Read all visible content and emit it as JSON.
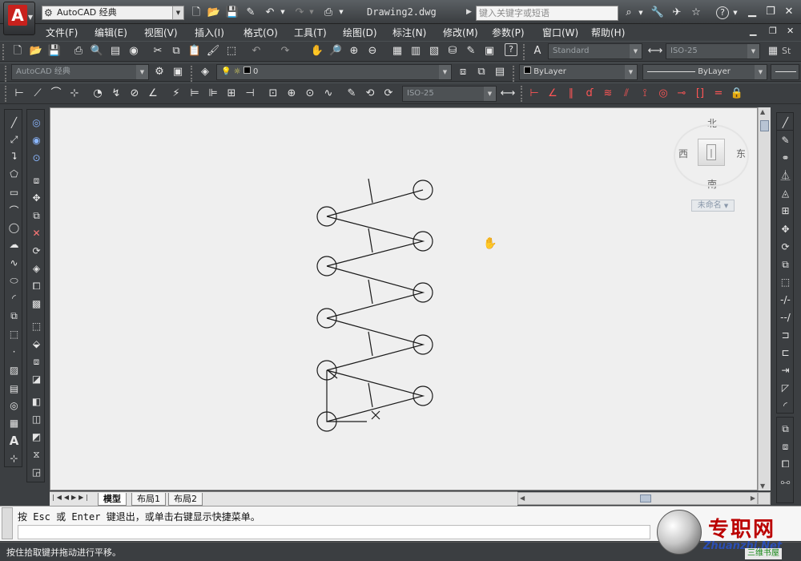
{
  "app": {
    "workspace": "AutoCAD 经典",
    "document_title": "Drawing2.dwg",
    "search_placeholder": "键入关键字或短语"
  },
  "menu": [
    "文件(F)",
    "编辑(E)",
    "视图(V)",
    "插入(I)",
    "格式(O)",
    "工具(T)",
    "绘图(D)",
    "标注(N)",
    "修改(M)",
    "参数(P)",
    "窗口(W)",
    "帮助(H)"
  ],
  "toolbars": {
    "text_style": "Standard",
    "dim_style": "ISO-25",
    "workspace_combo": "AutoCAD 经典",
    "layer_value": "0",
    "color_value": "ByLayer",
    "linetype_value": "ByLayer",
    "dim_style2": "ISO-25",
    "table_style_label": "St"
  },
  "viewcube": {
    "north": "北",
    "south": "南",
    "east": "东",
    "west": "西",
    "ucs": "未命名"
  },
  "layout_tabs": [
    "模型",
    "布局1",
    "布局2"
  ],
  "command": {
    "prompt": "按 Esc 或 Enter 键退出，或单击右键显示快捷菜单。"
  },
  "status_bar": {
    "message": "按住拾取键并拖动进行平移。"
  },
  "watermark": {
    "title": "专职网",
    "url": "Zhuanzhi.Net",
    "sub": "三维书屋"
  },
  "colors": {
    "accent": "#c8211d",
    "canvas": "#efefef",
    "chrome": "#3b3e41"
  }
}
